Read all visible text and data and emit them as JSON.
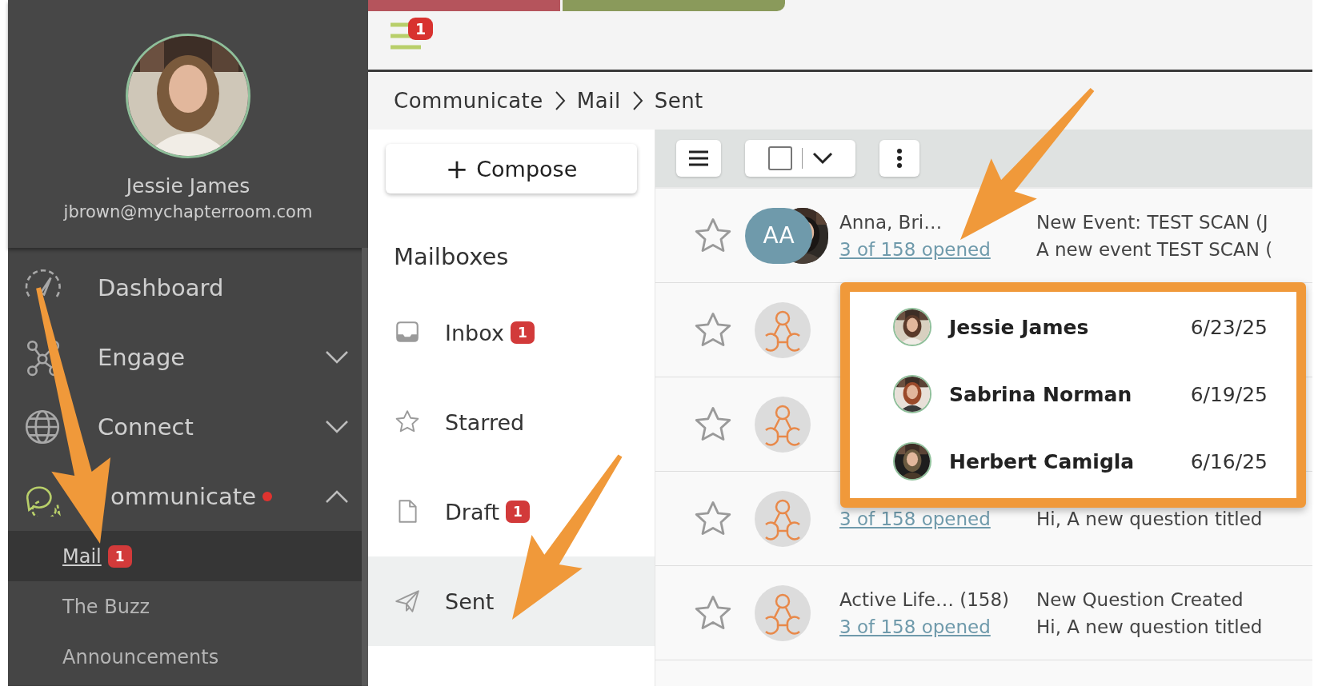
{
  "top_bar": {
    "menu_badge": "1"
  },
  "profile": {
    "name": "Jessie James",
    "email": "jbrown@mychapterroom.com"
  },
  "nav": [
    {
      "label": "Dashboard",
      "kind": "link",
      "notification": false
    },
    {
      "label": "Engage",
      "kind": "group",
      "expanded": false,
      "notification": false
    },
    {
      "label": "Connect",
      "kind": "group",
      "expanded": false,
      "notification": false
    },
    {
      "label": "ommunicate",
      "kind": "group",
      "expanded": true,
      "notification": true,
      "children": [
        {
          "label": "Mail",
          "selected": true,
          "badge": "1"
        },
        {
          "label": "The Buzz",
          "selected": false
        },
        {
          "label": "Announcements",
          "selected": false
        }
      ]
    }
  ],
  "breadcrumb": [
    "Communicate",
    "Mail",
    "Sent"
  ],
  "compose": {
    "icon": "+",
    "label": "Compose"
  },
  "mailboxes_title": "Mailboxes",
  "mailboxes": [
    {
      "label": "Inbox",
      "badge": "1",
      "selected": false
    },
    {
      "label": "Starred",
      "selected": false
    },
    {
      "label": "Draft",
      "badge": "1",
      "selected": false
    },
    {
      "label": "Sent",
      "selected": true
    }
  ],
  "toolbar": {
    "select_all_checked": false
  },
  "messages": [
    {
      "starred": false,
      "kind": "initials",
      "initials": "AA",
      "sender": "Anna, Bri…",
      "subject": "New Event: TEST SCAN (J",
      "opened": "3 of 158 opened",
      "preview": "A new event TEST SCAN ("
    },
    {
      "starred": false,
      "kind": "group"
    },
    {
      "starred": false,
      "kind": "group"
    },
    {
      "starred": false,
      "kind": "group",
      "opened": "3 of 158 opened",
      "preview": "Hi, A new question titled"
    },
    {
      "starred": false,
      "kind": "group",
      "sender": "Active Life… (158)",
      "subject": "New Question Created",
      "opened": "3 of 158 opened",
      "preview": "Hi, A new question titled"
    }
  ],
  "opened_popup": [
    {
      "name": "Jessie James",
      "date": "6/23/25"
    },
    {
      "name": "Sabrina Norman",
      "date": "6/19/25"
    },
    {
      "name": "Herbert Camigla",
      "date": "6/16/25"
    }
  ]
}
